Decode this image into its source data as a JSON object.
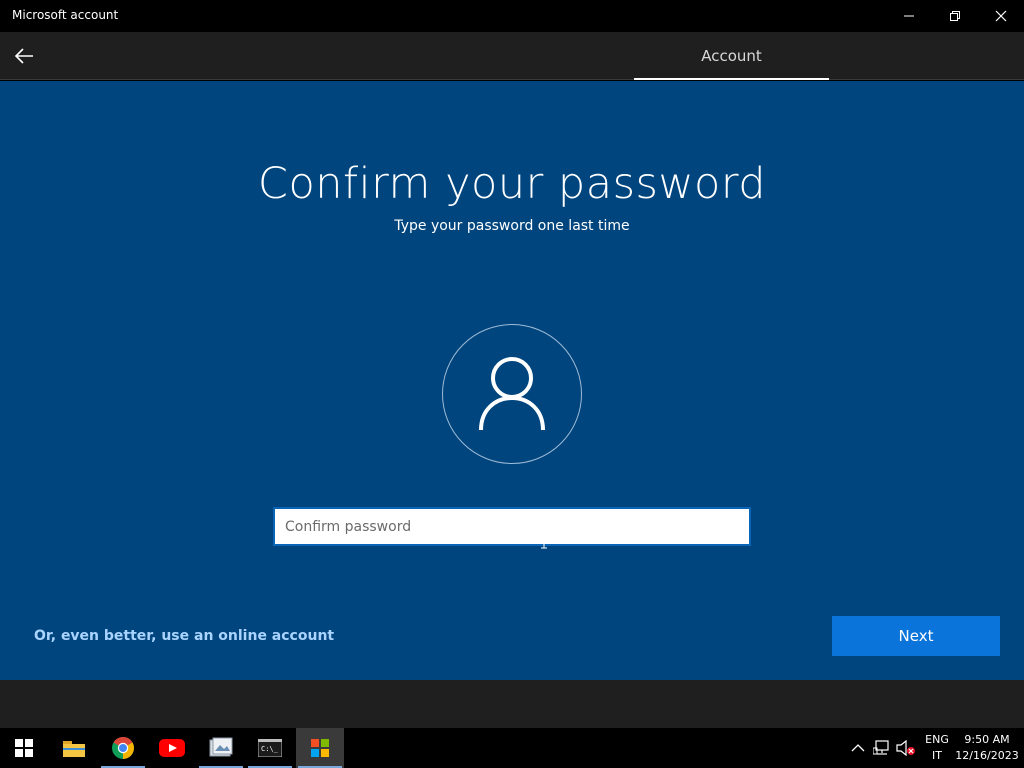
{
  "window": {
    "title": "Microsoft account",
    "minimize_icon": "minimize-icon",
    "maximize_icon": "restore-icon",
    "close_icon": "close-icon"
  },
  "nav": {
    "back_icon": "back-arrow-icon",
    "tab_label": "Account"
  },
  "main": {
    "heading": "Confirm your password",
    "subheading": "Type your password one last time",
    "avatar_icon": "user-icon",
    "password_input": {
      "placeholder": "Confirm password",
      "value": ""
    },
    "online_account_link": "Or, even better, use an online account",
    "next_label": "Next"
  },
  "taskbar": {
    "items": [
      {
        "name": "start-button",
        "icon": "windows-logo-icon"
      },
      {
        "name": "file-explorer",
        "icon": "folder-icon"
      },
      {
        "name": "chrome",
        "icon": "chrome-icon"
      },
      {
        "name": "youtube",
        "icon": "youtube-icon"
      },
      {
        "name": "photos",
        "icon": "photos-icon"
      },
      {
        "name": "terminal",
        "icon": "terminal-icon"
      },
      {
        "name": "microsoft-store",
        "icon": "microsoft-logo-icon"
      }
    ],
    "tray": {
      "chevron_icon": "chevron-up-icon",
      "network_icon": "network-icon",
      "volume_icon": "volume-muted-icon",
      "language_line1": "ENG",
      "language_line2": "IT",
      "time": "9:50 AM",
      "date": "12/16/2023"
    }
  },
  "colors": {
    "main_bg": "#00457e",
    "accent": "#0a74da",
    "link": "#a9d4ff"
  }
}
